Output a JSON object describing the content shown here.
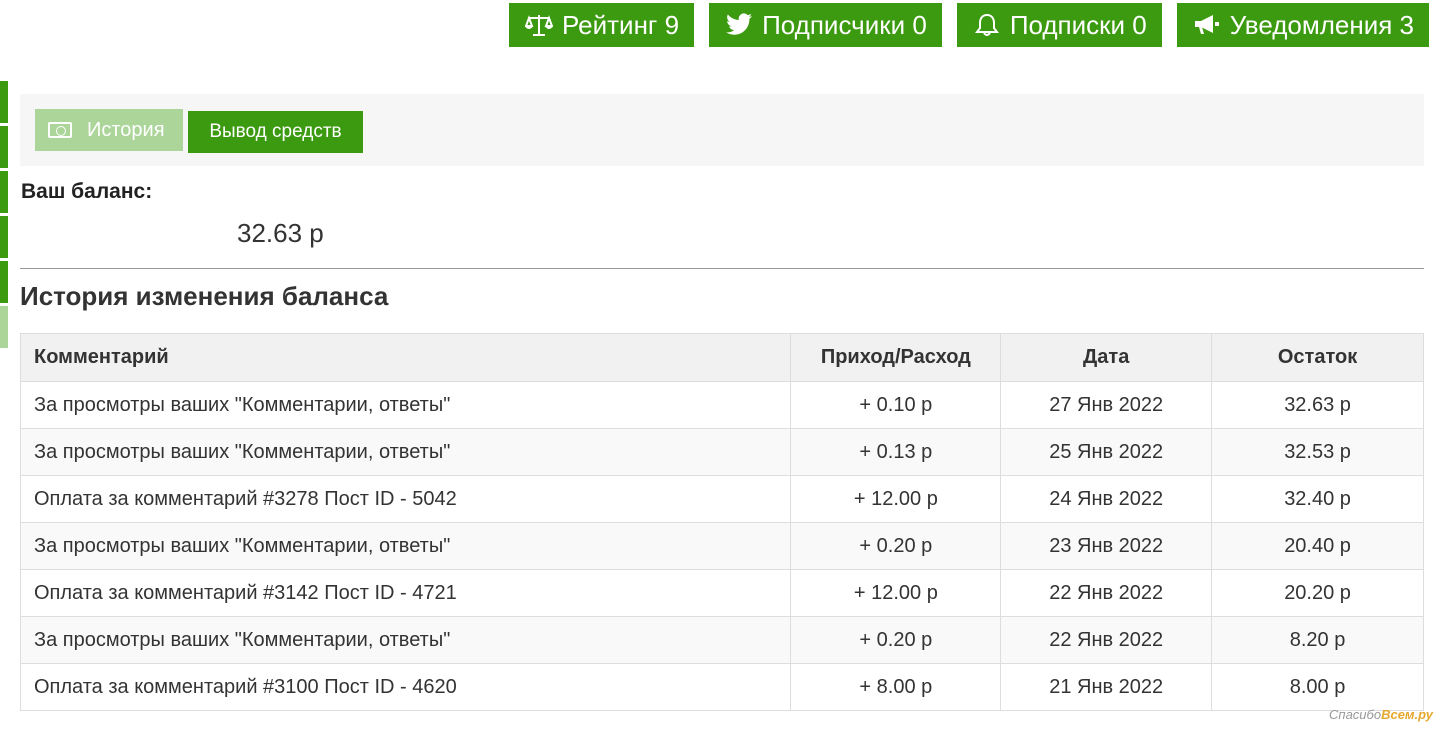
{
  "topnav": {
    "rating": "Рейтинг 9",
    "followers": "Подписчики 0",
    "subscriptions": "Подписки 0",
    "notifications": "Уведомления 3"
  },
  "tabs": {
    "history": "История",
    "withdraw": "Вывод средств"
  },
  "balance": {
    "label": "Ваш баланс:",
    "value": "32.63 р"
  },
  "history": {
    "title": "История изменения баланса",
    "columns": [
      "Комментарий",
      "Приход/Расход",
      "Дата",
      "Остаток"
    ],
    "rows": [
      [
        "За просмотры ваших \"Комментарии, ответы\"",
        "+ 0.10 р",
        "27 Янв 2022",
        "32.63 р"
      ],
      [
        "За просмотры ваших \"Комментарии, ответы\"",
        "+ 0.13 р",
        "25 Янв 2022",
        "32.53 р"
      ],
      [
        "Оплата за комментарий #3278 Пост ID - 5042",
        "+ 12.00 р",
        "24 Янв 2022",
        "32.40 р"
      ],
      [
        "За просмотры ваших \"Комментарии, ответы\"",
        "+ 0.20 р",
        "23 Янв 2022",
        "20.40 р"
      ],
      [
        "Оплата за комментарий #3142 Пост ID - 4721",
        "+ 12.00 р",
        "22 Янв 2022",
        "20.20 р"
      ],
      [
        "За просмотры ваших \"Комментарии, ответы\"",
        "+ 0.20 р",
        "22 Янв 2022",
        "8.20 р"
      ],
      [
        "Оплата за комментарий #3100 Пост ID - 4620",
        "+ 8.00 р",
        "21 Янв 2022",
        "8.00 р"
      ]
    ]
  },
  "watermark": {
    "prefix": "Спасибо",
    "brand": "Всем.ру"
  },
  "colors": {
    "accent": "#3c9a10",
    "accent_light": "#acd59a",
    "panel_bg": "#f5f6f5"
  },
  "icons": {
    "rating": "scales-icon",
    "followers": "twitter-icon",
    "subscriptions": "bell-icon",
    "notifications": "megaphone-icon",
    "history_tab": "cash-icon"
  }
}
